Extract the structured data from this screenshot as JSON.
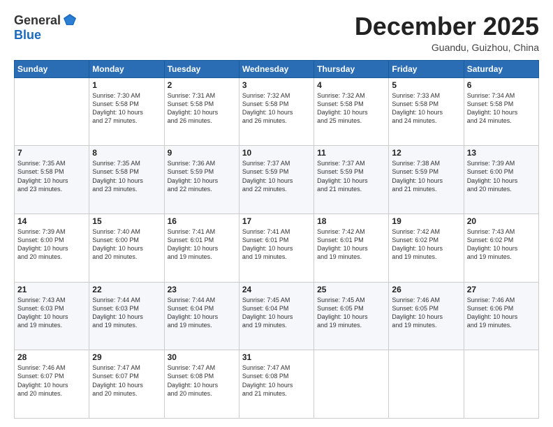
{
  "header": {
    "logo_line1": "General",
    "logo_line2": "Blue",
    "month": "December 2025",
    "location": "Guandu, Guizhou, China"
  },
  "days_of_week": [
    "Sunday",
    "Monday",
    "Tuesday",
    "Wednesday",
    "Thursday",
    "Friday",
    "Saturday"
  ],
  "weeks": [
    [
      {
        "day": "",
        "info": ""
      },
      {
        "day": "1",
        "info": "Sunrise: 7:30 AM\nSunset: 5:58 PM\nDaylight: 10 hours\nand 27 minutes."
      },
      {
        "day": "2",
        "info": "Sunrise: 7:31 AM\nSunset: 5:58 PM\nDaylight: 10 hours\nand 26 minutes."
      },
      {
        "day": "3",
        "info": "Sunrise: 7:32 AM\nSunset: 5:58 PM\nDaylight: 10 hours\nand 26 minutes."
      },
      {
        "day": "4",
        "info": "Sunrise: 7:32 AM\nSunset: 5:58 PM\nDaylight: 10 hours\nand 25 minutes."
      },
      {
        "day": "5",
        "info": "Sunrise: 7:33 AM\nSunset: 5:58 PM\nDaylight: 10 hours\nand 24 minutes."
      },
      {
        "day": "6",
        "info": "Sunrise: 7:34 AM\nSunset: 5:58 PM\nDaylight: 10 hours\nand 24 minutes."
      }
    ],
    [
      {
        "day": "7",
        "info": "Sunrise: 7:35 AM\nSunset: 5:58 PM\nDaylight: 10 hours\nand 23 minutes."
      },
      {
        "day": "8",
        "info": "Sunrise: 7:35 AM\nSunset: 5:58 PM\nDaylight: 10 hours\nand 23 minutes."
      },
      {
        "day": "9",
        "info": "Sunrise: 7:36 AM\nSunset: 5:59 PM\nDaylight: 10 hours\nand 22 minutes."
      },
      {
        "day": "10",
        "info": "Sunrise: 7:37 AM\nSunset: 5:59 PM\nDaylight: 10 hours\nand 22 minutes."
      },
      {
        "day": "11",
        "info": "Sunrise: 7:37 AM\nSunset: 5:59 PM\nDaylight: 10 hours\nand 21 minutes."
      },
      {
        "day": "12",
        "info": "Sunrise: 7:38 AM\nSunset: 5:59 PM\nDaylight: 10 hours\nand 21 minutes."
      },
      {
        "day": "13",
        "info": "Sunrise: 7:39 AM\nSunset: 6:00 PM\nDaylight: 10 hours\nand 20 minutes."
      }
    ],
    [
      {
        "day": "14",
        "info": "Sunrise: 7:39 AM\nSunset: 6:00 PM\nDaylight: 10 hours\nand 20 minutes."
      },
      {
        "day": "15",
        "info": "Sunrise: 7:40 AM\nSunset: 6:00 PM\nDaylight: 10 hours\nand 20 minutes."
      },
      {
        "day": "16",
        "info": "Sunrise: 7:41 AM\nSunset: 6:01 PM\nDaylight: 10 hours\nand 19 minutes."
      },
      {
        "day": "17",
        "info": "Sunrise: 7:41 AM\nSunset: 6:01 PM\nDaylight: 10 hours\nand 19 minutes."
      },
      {
        "day": "18",
        "info": "Sunrise: 7:42 AM\nSunset: 6:01 PM\nDaylight: 10 hours\nand 19 minutes."
      },
      {
        "day": "19",
        "info": "Sunrise: 7:42 AM\nSunset: 6:02 PM\nDaylight: 10 hours\nand 19 minutes."
      },
      {
        "day": "20",
        "info": "Sunrise: 7:43 AM\nSunset: 6:02 PM\nDaylight: 10 hours\nand 19 minutes."
      }
    ],
    [
      {
        "day": "21",
        "info": "Sunrise: 7:43 AM\nSunset: 6:03 PM\nDaylight: 10 hours\nand 19 minutes."
      },
      {
        "day": "22",
        "info": "Sunrise: 7:44 AM\nSunset: 6:03 PM\nDaylight: 10 hours\nand 19 minutes."
      },
      {
        "day": "23",
        "info": "Sunrise: 7:44 AM\nSunset: 6:04 PM\nDaylight: 10 hours\nand 19 minutes."
      },
      {
        "day": "24",
        "info": "Sunrise: 7:45 AM\nSunset: 6:04 PM\nDaylight: 10 hours\nand 19 minutes."
      },
      {
        "day": "25",
        "info": "Sunrise: 7:45 AM\nSunset: 6:05 PM\nDaylight: 10 hours\nand 19 minutes."
      },
      {
        "day": "26",
        "info": "Sunrise: 7:46 AM\nSunset: 6:05 PM\nDaylight: 10 hours\nand 19 minutes."
      },
      {
        "day": "27",
        "info": "Sunrise: 7:46 AM\nSunset: 6:06 PM\nDaylight: 10 hours\nand 19 minutes."
      }
    ],
    [
      {
        "day": "28",
        "info": "Sunrise: 7:46 AM\nSunset: 6:07 PM\nDaylight: 10 hours\nand 20 minutes."
      },
      {
        "day": "29",
        "info": "Sunrise: 7:47 AM\nSunset: 6:07 PM\nDaylight: 10 hours\nand 20 minutes."
      },
      {
        "day": "30",
        "info": "Sunrise: 7:47 AM\nSunset: 6:08 PM\nDaylight: 10 hours\nand 20 minutes."
      },
      {
        "day": "31",
        "info": "Sunrise: 7:47 AM\nSunset: 6:08 PM\nDaylight: 10 hours\nand 21 minutes."
      },
      {
        "day": "",
        "info": ""
      },
      {
        "day": "",
        "info": ""
      },
      {
        "day": "",
        "info": ""
      }
    ]
  ]
}
